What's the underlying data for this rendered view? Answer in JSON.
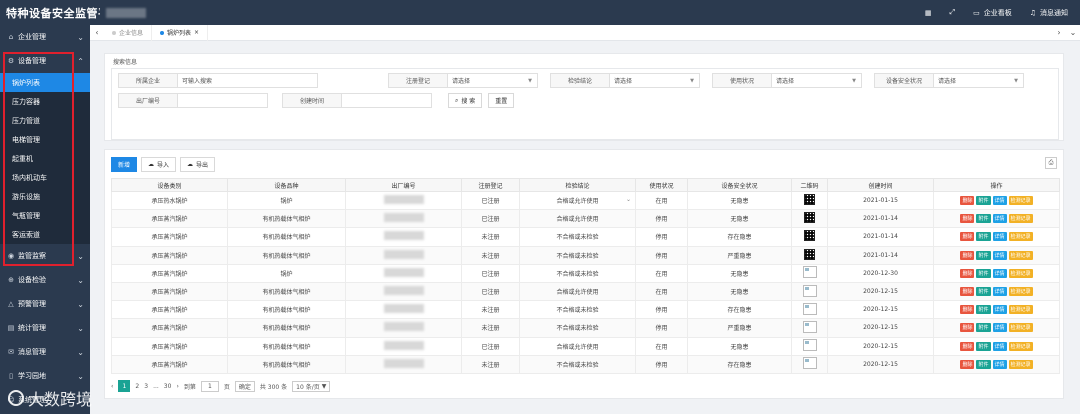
{
  "header": {
    "title": "特种设备安全监管平台",
    "links": [
      {
        "icon": "grid-icon",
        "label": ""
      },
      {
        "icon": "expand-icon",
        "label": ""
      },
      {
        "icon": "monitor-icon",
        "label": "企业看板"
      },
      {
        "icon": "bell-icon",
        "label": "消息通知"
      }
    ]
  },
  "sidebar": {
    "items": [
      {
        "icon": "home-icon",
        "label": "企业管理"
      },
      {
        "icon": "gear-icon",
        "label": "设备管理",
        "expanded": true
      },
      {
        "icon": "eye-icon",
        "label": "监管监察"
      },
      {
        "icon": "check-icon",
        "label": "设备检验"
      },
      {
        "icon": "alert-icon",
        "label": "预警管理"
      },
      {
        "icon": "chart-icon",
        "label": "统计管理"
      },
      {
        "icon": "message-icon",
        "label": "消息管理"
      },
      {
        "icon": "book-icon",
        "label": "学习园地"
      },
      {
        "icon": "user-icon",
        "label": "系统管理"
      }
    ],
    "sub_items": [
      "锅炉列表",
      "压力容器",
      "压力管道",
      "电梯管理",
      "起重机",
      "场内机动车",
      "游乐设施",
      "气瓶管理",
      "客运索道"
    ],
    "active_sub": "锅炉列表"
  },
  "tabs": [
    {
      "label": "企业信息",
      "active": false
    },
    {
      "label": "锅炉列表",
      "active": true,
      "close": "×"
    }
  ],
  "search": {
    "legend": "搜索信息",
    "fields": [
      {
        "label": "所属企业",
        "value": "可输入搜索"
      },
      {
        "label": "注册登记",
        "value": "请选择"
      },
      {
        "label": "检验结论",
        "value": "请选择"
      },
      {
        "label": "使用状况",
        "value": "请选择"
      },
      {
        "label": "设备安全状况",
        "value": "请选择"
      },
      {
        "label": "出厂编号",
        "value": ""
      },
      {
        "label": "创建时间",
        "value": ""
      }
    ],
    "search_label": "搜 索",
    "reset_label": "重置"
  },
  "toolbar": {
    "add_label": "新增",
    "import_label": "导入",
    "export_label": "导出"
  },
  "table": {
    "columns": [
      "设备类别",
      "设备品种",
      "出厂编号",
      "注册登记",
      "检验结论",
      "使用状况",
      "设备安全状况",
      "二维码",
      "创建时间",
      "操作"
    ],
    "actions": [
      "删除",
      "附件",
      "详情",
      "检测记录"
    ],
    "rows": [
      {
        "category": "承压热水锅炉",
        "variety": "锅炉",
        "reg": "已注册",
        "conclusion": "合格或允许使用",
        "status": "在用",
        "safety": "无隐患",
        "qr": "qr",
        "date": "2021-01-15",
        "dropdown": true
      },
      {
        "category": "承压蒸汽锅炉",
        "variety": "有机热载体气相炉",
        "reg": "已注册",
        "conclusion": "合格或允许使用",
        "status": "停用",
        "safety": "无隐患",
        "qr": "qr",
        "date": "2021-01-14"
      },
      {
        "category": "承压蒸汽锅炉",
        "variety": "有机热载体气相炉",
        "reg": "未注册",
        "conclusion": "不合格或未检验",
        "status": "停用",
        "safety": "存在隐患",
        "qr": "qr",
        "date": "2021-01-14"
      },
      {
        "category": "承压蒸汽锅炉",
        "variety": "有机热载体气相炉",
        "reg": "未注册",
        "conclusion": "不合格或未检验",
        "status": "停用",
        "safety": "严重隐患",
        "qr": "qr",
        "date": "2021-01-14"
      },
      {
        "category": "承压蒸汽锅炉",
        "variety": "锅炉",
        "reg": "已注册",
        "conclusion": "不合格或未检验",
        "status": "在用",
        "safety": "无隐患",
        "qr": "img",
        "date": "2020-12-30"
      },
      {
        "category": "承压蒸汽锅炉",
        "variety": "有机热载体气相炉",
        "reg": "已注册",
        "conclusion": "合格或允许使用",
        "status": "在用",
        "safety": "无隐患",
        "qr": "img",
        "date": "2020-12-15"
      },
      {
        "category": "承压蒸汽锅炉",
        "variety": "有机热载体气相炉",
        "reg": "未注册",
        "conclusion": "不合格或未检验",
        "status": "停用",
        "safety": "存在隐患",
        "qr": "img",
        "date": "2020-12-15"
      },
      {
        "category": "承压蒸汽锅炉",
        "variety": "有机热载体气相炉",
        "reg": "未注册",
        "conclusion": "不合格或未检验",
        "status": "停用",
        "safety": "严重隐患",
        "qr": "img",
        "date": "2020-12-15"
      },
      {
        "category": "承压蒸汽锅炉",
        "variety": "有机热载体气相炉",
        "reg": "已注册",
        "conclusion": "合格或允许使用",
        "status": "在用",
        "safety": "无隐患",
        "qr": "img",
        "date": "2020-12-15"
      },
      {
        "category": "承压蒸汽锅炉",
        "variety": "有机热载体气相炉",
        "reg": "未注册",
        "conclusion": "不合格或未检验",
        "status": "停用",
        "safety": "存在隐患",
        "qr": "img",
        "date": "2020-12-15"
      }
    ]
  },
  "pager": {
    "pages": [
      "1",
      "2",
      "3",
      "...",
      "30"
    ],
    "goto_label": "到第",
    "goto_value": "1",
    "page_unit": "页",
    "confirm_label": "确定",
    "total": "共 300 条",
    "page_size": "10 条/页"
  },
  "watermark": "大数跨境",
  "colors": {
    "sidebar": "#2b3a4f",
    "primary": "#1e88e5",
    "highlight": "#e0202d"
  }
}
